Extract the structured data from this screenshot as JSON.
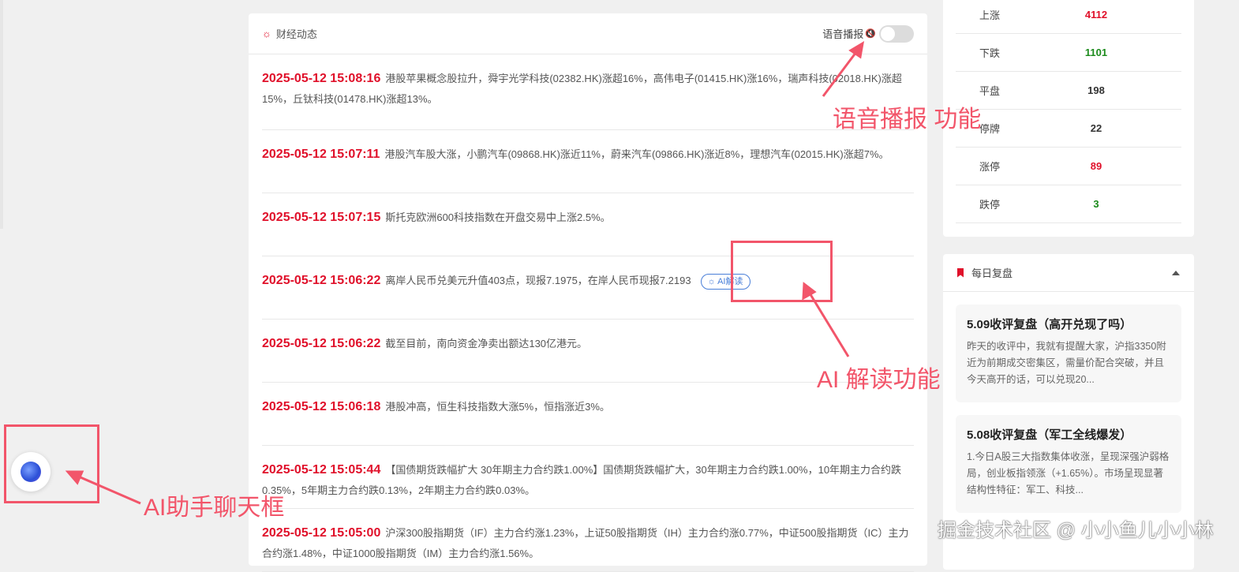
{
  "news": {
    "title": "财经动态",
    "voice_label": "语音播报",
    "ai_button": "AI解读",
    "items": [
      {
        "time": "2025-05-12 15:08:16",
        "text": "港股苹果概念股拉升，舜宇光学科技(02382.HK)涨超16%，高伟电子(01415.HK)涨16%，瑞声科技(02018.HK)涨超15%，丘钛科技(01478.HK)涨超13%。"
      },
      {
        "time": "2025-05-12 15:07:11",
        "text": "港股汽车股大涨，小鹏汽车(09868.HK)涨近11%，蔚来汽车(09866.HK)涨近8%，理想汽车(02015.HK)涨超7%。"
      },
      {
        "time": "2025-05-12 15:07:15",
        "text": "斯托克欧洲600科技指数在开盘交易中上涨2.5%。"
      },
      {
        "time": "2025-05-12 15:06:22",
        "text": "离岸人民币兑美元升值403点，现报7.1975，在岸人民币现报7.2193"
      },
      {
        "time": "2025-05-12 15:06:22",
        "text": "截至目前，南向资金净卖出额达130亿港元。"
      },
      {
        "time": "2025-05-12 15:06:18",
        "text": "港股冲高，恒生科技指数大涨5%，恒指涨近3%。"
      },
      {
        "time": "2025-05-12 15:05:44",
        "text": "【国债期货跌幅扩大 30年期主力合约跌1.00%】国债期货跌幅扩大，30年期主力合约跌1.00%，10年期主力合约跌0.35%，5年期主力合约跌0.13%，2年期主力合约跌0.03%。"
      },
      {
        "time": "2025-05-12 15:05:00",
        "text": "沪深300股指期货（IF）主力合约涨1.23%，上证50股指期货（IH）主力合约涨0.77%，中证500股指期货（IC）主力合约涨1.48%，中证1000股指期货（IM）主力合约涨1.56%。"
      }
    ]
  },
  "stats": [
    {
      "label": "上涨",
      "value": "4112",
      "color": "#e0102a"
    },
    {
      "label": "下跌",
      "value": "1101",
      "color": "#1a8a1a"
    },
    {
      "label": "平盘",
      "value": "198",
      "color": "#333333"
    },
    {
      "label": "停牌",
      "value": "22",
      "color": "#333333"
    },
    {
      "label": "涨停",
      "value": "89",
      "color": "#e0102a"
    },
    {
      "label": "跌停",
      "value": "3",
      "color": "#1a8a1a"
    }
  ],
  "review": {
    "title": "每日复盘",
    "items": [
      {
        "title": "5.09收评复盘（高开兑现了吗）",
        "text": "昨天的收评中，我就有提醒大家，沪指3350附近为前期成交密集区，需量价配合突破，并且今天高开的话，可以兑现20..."
      },
      {
        "title": "5.08收评复盘（军工全线爆发）",
        "text": "1.今日A股三大指数集体收涨，呈现深强沪弱格局，创业板指领涨（+1.65%）。市场呈现显著结构性特征：军工、科技..."
      }
    ]
  },
  "annotations": {
    "voice": "语音播报 功能",
    "ai": "AI 解读功能",
    "chat": "AI助手聊天框"
  },
  "watermark": "掘金技术社区 @ 小小鱼儿小小林"
}
